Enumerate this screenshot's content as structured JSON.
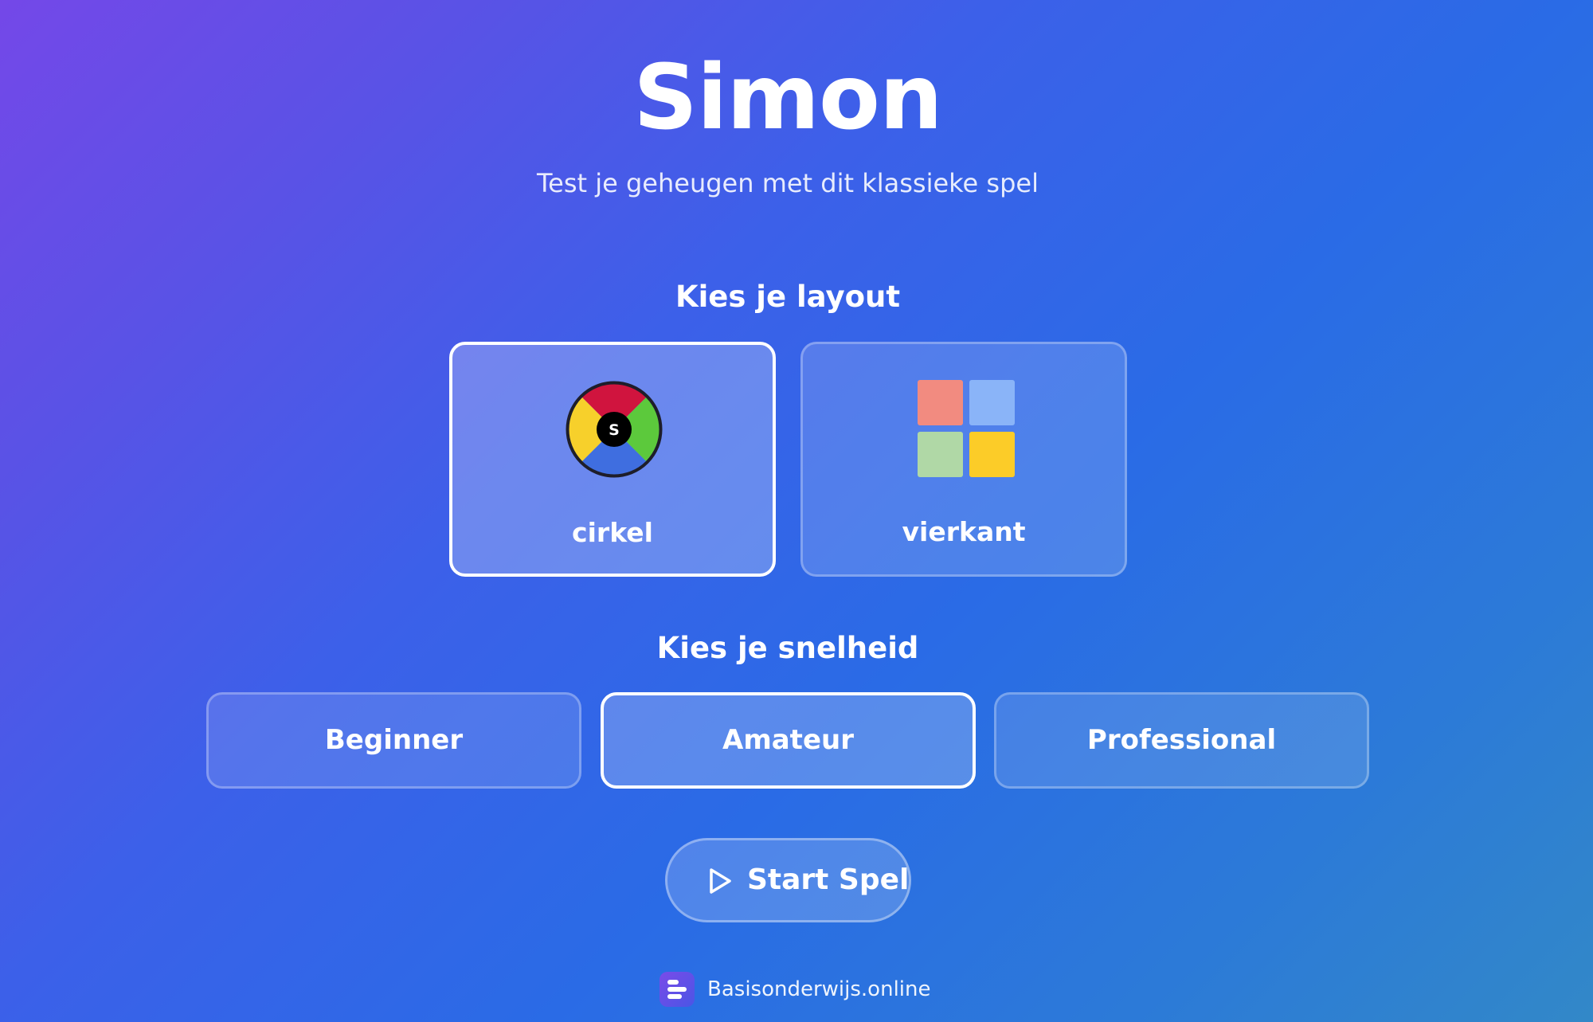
{
  "app": {
    "title": "Simon",
    "subtitle": "Test je geheugen met dit klassieke spel"
  },
  "layout_section": {
    "heading": "Kies je layout",
    "options": [
      {
        "label": "cirkel",
        "selected": true,
        "center_letter": "S"
      },
      {
        "label": "vierkant",
        "selected": false
      }
    ]
  },
  "speed_section": {
    "heading": "Kies je snelheid",
    "options": [
      {
        "label": "Beginner",
        "selected": false
      },
      {
        "label": "Amateur",
        "selected": true
      },
      {
        "label": "Professional",
        "selected": false
      }
    ]
  },
  "start_button": {
    "label": "Start Spel",
    "icon": "play-icon"
  },
  "footer": {
    "text": "Basisonderwijs.online",
    "icon": "basisonderwijs-logo-icon"
  },
  "colors": {
    "circle_red": "#d0143e",
    "circle_green": "#5cc93c",
    "circle_blue": "#3f6ee0",
    "circle_yellow": "#f7d02b",
    "circle_center": "#000000",
    "tile_red": "#f28b80",
    "tile_blue": "#8ab4f8",
    "tile_green": "#b0d8a6",
    "tile_yellow": "#fccc28"
  }
}
